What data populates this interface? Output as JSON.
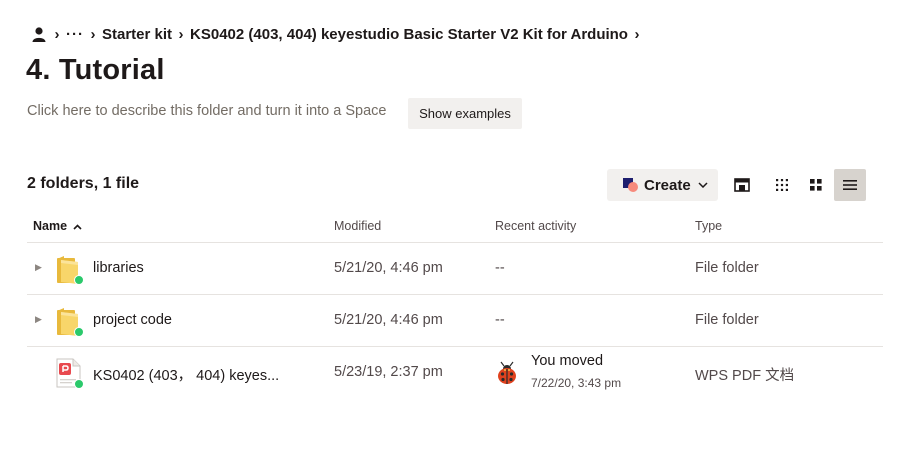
{
  "breadcrumb": {
    "overflow_label": "···",
    "items": [
      "Starter kit",
      "KS0402 (403, 404) keyestudio Basic Starter V2 Kit for Arduino"
    ]
  },
  "page_title": "4. Tutorial",
  "description_prompt": "Click here to describe this folder and turn it into a Space",
  "show_examples_label": "Show examples",
  "item_count": "2 folders, 1 file",
  "toolbar": {
    "create_label": "Create"
  },
  "columns": {
    "name": "Name",
    "modified": "Modified",
    "activity": "Recent activity",
    "type": "Type"
  },
  "rows": [
    {
      "name": "libraries",
      "modified": "5/21/20, 4:46 pm",
      "activity": "--",
      "type": "File folder",
      "icon": "folder-icon"
    },
    {
      "name": "project code",
      "modified": "5/21/20, 4:46 pm",
      "activity": "--",
      "type": "File folder",
      "icon": "folder-icon"
    },
    {
      "name": "KS0402 (403， 404) keyes...",
      "modified": "5/23/19, 2:37 pm",
      "activity_line1": "You moved",
      "activity_line2": "7/22/20, 3:43 pm",
      "type": "WPS PDF 文档",
      "icon": "pdf-icon"
    }
  ],
  "colors": {
    "text_primary": "#1e1919",
    "text_secondary": "#52494a",
    "button_bg": "#f2f0ee",
    "active_view_bg": "#d7d3ce",
    "sync_green": "#2bc96b",
    "folder_yellow": "#f5cf5b"
  }
}
